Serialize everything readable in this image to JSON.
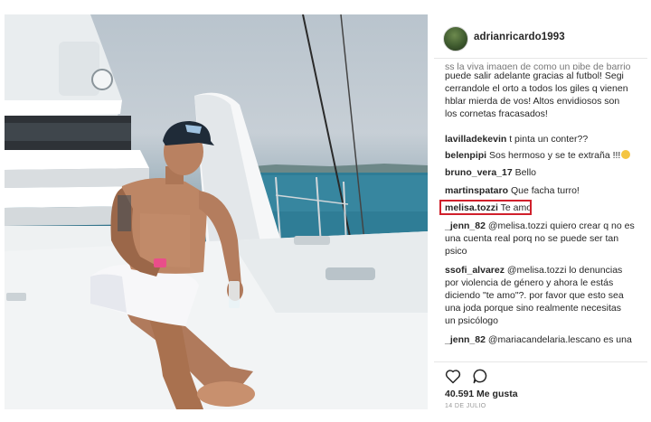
{
  "post": {
    "username": "adrianricardo1993",
    "caption": {
      "faded_line": "ss la viva imagen de como un pibe de barrio",
      "lines": [
        "puede salir adelante gracias al futbol! Segi",
        "cerrandole el orto a todos los giles q vienen",
        "hblar mierda de vos! Altos envidiosos son",
        "los cornetas fracasados!"
      ]
    },
    "comments": [
      {
        "user": "lavilladekevin",
        "text": "t pinta un conter??"
      },
      {
        "user": "belenpipi",
        "text": "Sos hermoso y se te extraña !!!"
      },
      {
        "user": "bruno_vera_17",
        "text": "Bello"
      },
      {
        "user": "martinspataro",
        "text": "Que facha turro!"
      },
      {
        "user": "melisa.tozzi",
        "text": "Te amo"
      },
      {
        "user": "_jenn_82",
        "mention": "@melisa.tozzi",
        "lines": [
          " quiero crear q no es",
          "una cuenta real porq no se puede ser tan",
          "psico"
        ]
      },
      {
        "user": "ssofi_alvarez",
        "mention": "@melisa.tozzi",
        "lines": [
          " lo denuncias",
          "por violencia de género y ahora le estás",
          "diciendo \"te amo\"?. por favor que esto sea",
          "una joda porque sino realmente necesitas",
          "un psicólogo"
        ]
      },
      {
        "user": "_jenn_82",
        "mention": "@mariacandelaria.lescano",
        "text": " es una"
      }
    ],
    "likes": "40.591 Me gusta",
    "date": "14 DE JULIO",
    "highlight_color": "#d0202b",
    "icons": [
      "heart-icon",
      "comment-icon"
    ]
  }
}
